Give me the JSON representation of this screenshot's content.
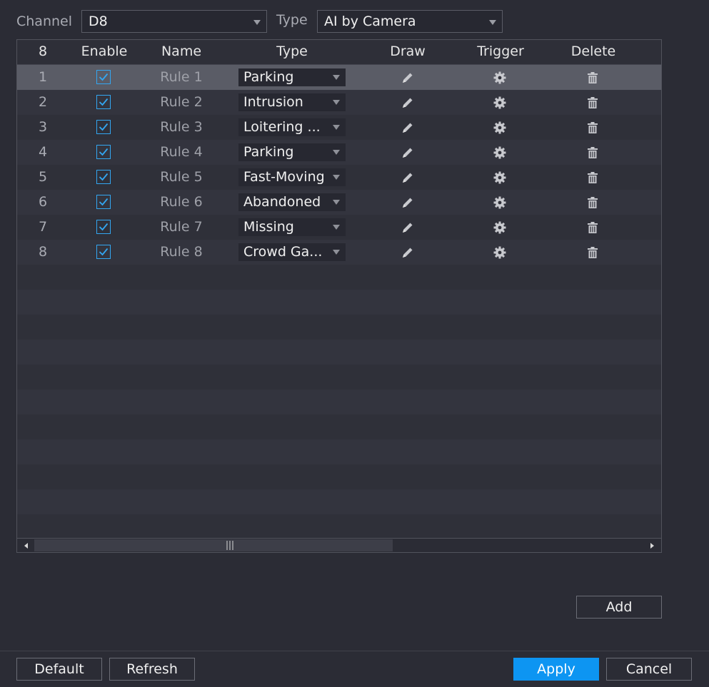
{
  "filters": {
    "channel_label": "Channel",
    "channel_value": "D8",
    "type_label": "Type",
    "type_value": "AI by Camera"
  },
  "table": {
    "headers": {
      "count": "8",
      "enable": "Enable",
      "name": "Name",
      "type": "Type",
      "draw": "Draw",
      "trigger": "Trigger",
      "delete": "Delete"
    },
    "rows": [
      {
        "num": "1",
        "enabled": true,
        "name": "Rule 1",
        "type": "Parking",
        "selected": true
      },
      {
        "num": "2",
        "enabled": true,
        "name": "Rule 2",
        "type": "Intrusion",
        "selected": false
      },
      {
        "num": "3",
        "enabled": true,
        "name": "Rule 3",
        "type": "Loitering ...",
        "selected": false
      },
      {
        "num": "4",
        "enabled": true,
        "name": "Rule 4",
        "type": "Parking",
        "selected": false
      },
      {
        "num": "5",
        "enabled": true,
        "name": "Rule 5",
        "type": "Fast-Moving",
        "selected": false
      },
      {
        "num": "6",
        "enabled": true,
        "name": "Rule 6",
        "type": "Abandoned",
        "selected": false
      },
      {
        "num": "7",
        "enabled": true,
        "name": "Rule 7",
        "type": "Missing",
        "selected": false
      },
      {
        "num": "8",
        "enabled": true,
        "name": "Rule 8",
        "type": "Crowd Ga...",
        "selected": false
      }
    ],
    "icons": {
      "draw": "pencil-icon",
      "trigger": "gear-icon",
      "delete": "trash-icon"
    }
  },
  "buttons": {
    "add": "Add",
    "default": "Default",
    "refresh": "Refresh",
    "apply": "Apply",
    "cancel": "Cancel"
  },
  "colors": {
    "accent": "#0d95f2",
    "checkbox": "#33a7f2",
    "background": "#2b2c35"
  }
}
